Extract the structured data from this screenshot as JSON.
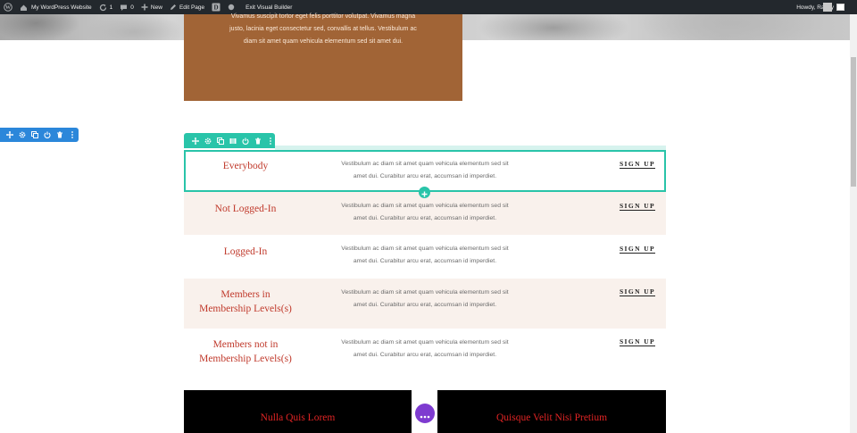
{
  "admin_bar": {
    "site_name": "My WordPress Website",
    "updates_count": "1",
    "comments_count": "0",
    "new_label": "New",
    "edit_page_label": "Edit Page",
    "exit_builder_label": "Exit Visual Builder",
    "greeting": "Howdy, Randy"
  },
  "hero_text": {
    "line1": "Vivamus suscipit tortor eget felis porttitor volutpat. Vivamus magna",
    "line2": "justo, lacinia eget consectetur sed, convallis at tellus. Vestibulum ac",
    "line3": "diam sit amet quam vehicula elementum sed sit amet dui."
  },
  "pricing_rows": [
    {
      "title_line1": "Everybody",
      "title_line2": "",
      "desc_line1": "Vestibulum ac diam sit amet quam vehicula elementum sed sit",
      "desc_line2": "amet dui. Curabitur arcu erat, accumsan id imperdiet.",
      "button": "SIGN UP"
    },
    {
      "title_line1": "Not Logged-In",
      "title_line2": "",
      "desc_line1": "Vestibulum ac diam sit amet quam vehicula elementum sed sit",
      "desc_line2": "amet dui. Curabitur arcu erat, accumsan id imperdiet.",
      "button": "SIGN UP"
    },
    {
      "title_line1": "Logged-In",
      "title_line2": "",
      "desc_line1": "Vestibulum ac diam sit amet quam vehicula elementum sed sit",
      "desc_line2": "amet dui. Curabitur arcu erat, accumsan id imperdiet.",
      "button": "SIGN UP"
    },
    {
      "title_line1": "Members in",
      "title_line2": "Membership Levels(s)",
      "desc_line1": "Vestibulum ac diam sit amet quam vehicula elementum sed sit",
      "desc_line2": "amet dui. Curabitur arcu erat, accumsan id imperdiet.",
      "button": "SIGN UP"
    },
    {
      "title_line1": "Members not in",
      "title_line2": "Membership Levels(s)",
      "desc_line1": "Vestibulum ac diam sit amet quam vehicula elementum sed sit",
      "desc_line2": "amet dui. Curabitur arcu erat, accumsan id imperdiet.",
      "button": "SIGN UP"
    }
  ],
  "bottom_panels": {
    "left_title": "Nulla Quis Lorem",
    "right_title": "Quisque Velit Nisi Pretium"
  },
  "colors": {
    "admin_bar": "#23282d",
    "section_toolbar": "#2b87da",
    "row_toolbar": "#29c4a9",
    "brown_box": "#a16436",
    "title_red": "#c0392b",
    "tint_row": "#f9f1ec",
    "more_button": "#7e3bd0"
  },
  "icons": {
    "admin_bar": [
      "wordpress-icon",
      "home-icon",
      "updates-icon",
      "comment-icon",
      "plus-icon",
      "pencil-icon",
      "divi-icon",
      "circle-icon"
    ],
    "section_toolbar": [
      "move-icon",
      "gear-icon",
      "duplicate-icon",
      "power-icon",
      "trash-icon",
      "kebab-icon"
    ],
    "row_toolbar": [
      "move-icon",
      "gear-icon",
      "duplicate-icon",
      "columns-icon",
      "power-icon",
      "trash-icon",
      "kebab-icon"
    ]
  }
}
